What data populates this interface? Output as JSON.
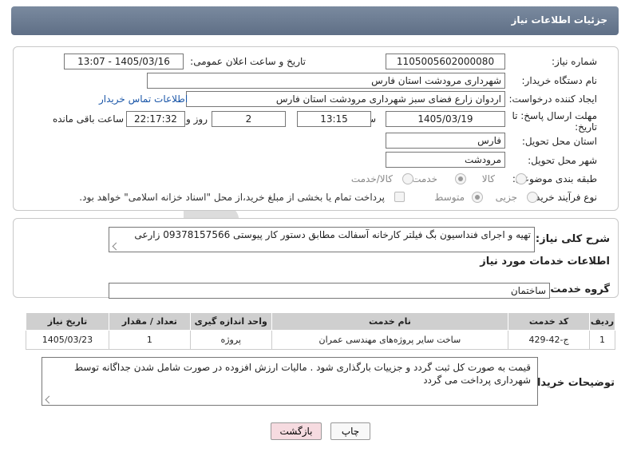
{
  "header": {
    "title": "جزئیات اطلاعات نیاز"
  },
  "form": {
    "need_number": {
      "label": "شماره نیاز:",
      "value": "1105005602000080"
    },
    "announce_datetime": {
      "label": "تاریخ و ساعت اعلان عمومی:",
      "value": "1405/03/16 - 13:07"
    },
    "buyer_org": {
      "label": "نام دستگاه خریدار:",
      "value": "شهرداری مرودشت استان فارس"
    },
    "requester": {
      "label": "ایجاد کننده درخواست:",
      "value": "اردوان زارع فضای سبز شهرداری مرودشت استان فارس",
      "contact_link": "اطلاعات تماس خریدار"
    },
    "deadline": {
      "label": "مهلت ارسال پاسخ: تا تاریخ:",
      "date": "1405/03/19",
      "time_label": "ساعت",
      "time": "13:15",
      "days": "2",
      "days_label": "روز و",
      "remaining": "22:17:32",
      "remaining_label": "ساعت باقی مانده"
    },
    "province": {
      "label": "استان محل تحویل:",
      "value": "فارس"
    },
    "city": {
      "label": "شهر محل تحویل:",
      "value": "مرودشت"
    },
    "category": {
      "label": "طبقه بندی موضوعی:",
      "options": [
        "کالا",
        "خدمت",
        "کالا/خدمت"
      ],
      "selected": "خدمت"
    },
    "purchase_type": {
      "label": "نوع فرآیند خرید :",
      "options": [
        "جزیی",
        "متوسط"
      ],
      "selected": "متوسط",
      "payment_note": "پرداخت تمام یا بخشی از مبلغ خرید،از محل \"اسناد خزانه اسلامی\" خواهد بود."
    }
  },
  "description": {
    "label": "شرح کلی نیاز:",
    "value": "تهیه و اجرای فنداسیون بگ فیلتر کارخانه آسفالت مطابق دستور کار پیوستی 09378157566 زارعی"
  },
  "services": {
    "section_title": "اطلاعات خدمات مورد نیاز",
    "group_label": "گروه خدمت:",
    "group_value": "ساختمان",
    "columns": [
      "ردیف",
      "کد خدمت",
      "نام خدمت",
      "واحد اندازه گیری",
      "تعداد / مقدار",
      "تاریخ نیاز"
    ],
    "rows": [
      {
        "row": "1",
        "code": "ج-42-429",
        "name": "ساخت سایر پروژه‌های مهندسی عمران",
        "unit": "پروژه",
        "qty": "1",
        "date": "1405/03/23"
      }
    ]
  },
  "buyer_notes": {
    "label": "توضیحات خریدار:",
    "value": "قیمت به صورت کل ثبت گردد و جزییات بارگذاری شود . مالیات ارزش افزوده در صورت شامل شدن جداگانه توسط شهرداری پرداخت می گردد"
  },
  "buttons": {
    "print": "چاپ",
    "back": "بازگشت"
  },
  "colors": {
    "title_bar": "#6b7b91",
    "table_header": "#cfcfcf",
    "back_button": "#f6dbe0",
    "link": "#1a56a8",
    "watermark": "#d9d9d9"
  },
  "watermark_text": "AriaTender.neT"
}
